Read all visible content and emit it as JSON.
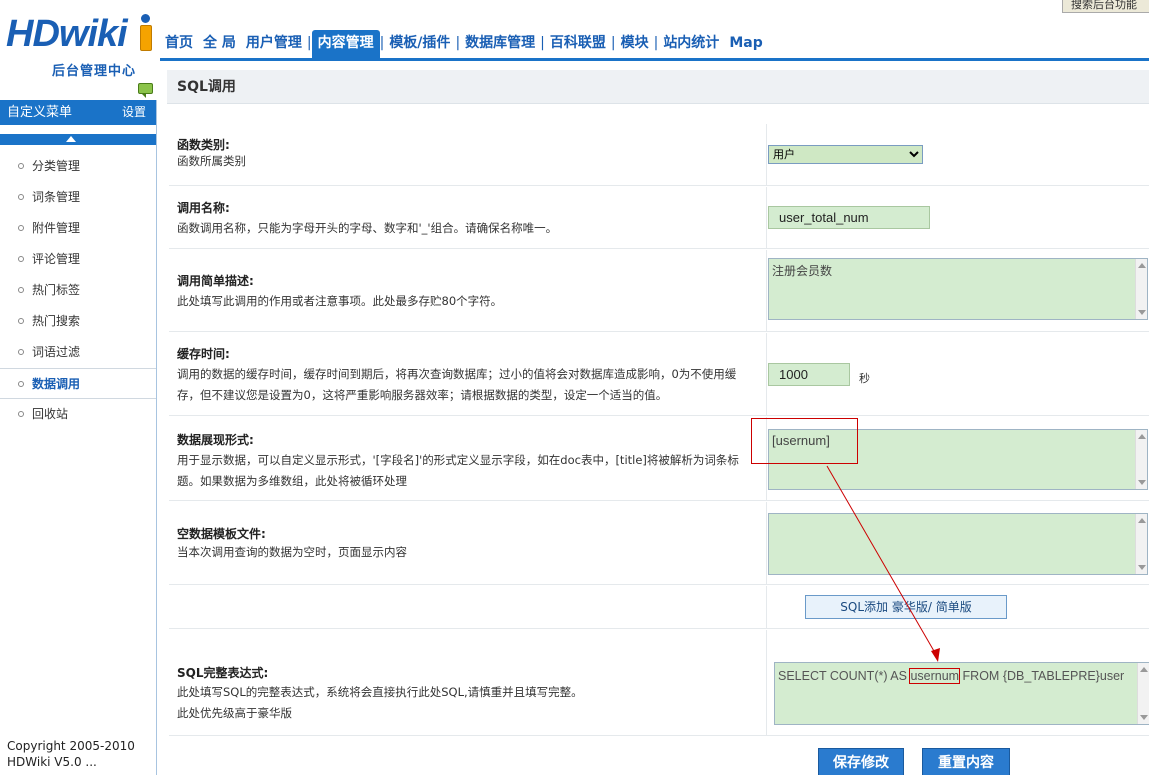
{
  "header": {
    "logo_text": "HDwiki",
    "logo_subtitle": "后台管理中心",
    "corner_hint": "搜索后台功能"
  },
  "nav": {
    "items": [
      {
        "label": "首页"
      },
      {
        "label": "全 局"
      },
      {
        "label": "用户管理"
      },
      {
        "label": "内容管理",
        "active": true
      },
      {
        "label": "模板/插件"
      },
      {
        "label": "数据库管理"
      },
      {
        "label": "百科联盟"
      },
      {
        "label": "模块"
      },
      {
        "label": "站内统计"
      },
      {
        "label": "Map"
      }
    ],
    "separator": "|"
  },
  "sidebar": {
    "title": "自定义菜单",
    "setting_label": "设置",
    "items": [
      {
        "label": "分类管理"
      },
      {
        "label": "词条管理"
      },
      {
        "label": "附件管理"
      },
      {
        "label": "评论管理"
      },
      {
        "label": "热门标签"
      },
      {
        "label": "热门搜索"
      },
      {
        "label": "词语过滤"
      },
      {
        "label": "数据调用",
        "active": true
      },
      {
        "label": "回收站"
      }
    ],
    "copyright_line1": "Copyright 2005-2010",
    "copyright_line2": "HDWiki V5.0 ..."
  },
  "page": {
    "title": "SQL调用"
  },
  "form": {
    "category": {
      "label": "函数类别:",
      "desc": "函数所属类别",
      "value": "用户"
    },
    "name": {
      "label": "调用名称:",
      "desc": "函数调用名称，只能为字母开头的字母、数字和'_'组合。请确保名称唯一。",
      "value": "user_total_num"
    },
    "summary": {
      "label": "调用简单描述:",
      "desc": "此处填写此调用的作用或者注意事项。此处最多存贮80个字符。",
      "value": "注册会员数"
    },
    "cache": {
      "label": "缓存时间:",
      "desc": "调用的数据的缓存时间，缓存时间到期后，将再次查询数据库；过小的值将会对数据库造成影响，0为不使用缓存，但不建议您是设置为0，这将严重影响服务器效率；请根据数据的类型，设定一个适当的值。",
      "value": "1000",
      "unit": "秒"
    },
    "display": {
      "label": "数据展现形式:",
      "desc": "用于显示数据，可以自定义显示形式，'[字段名]'的形式定义显示字段，如在doc表中，[title]将被解析为词条标题。如果数据为多维数组，此处将被循环处理",
      "value": "[usernum]"
    },
    "empty_tpl": {
      "label": "空数据模板文件:",
      "desc": "当本次调用查询的数据为空时，页面显示内容",
      "value": ""
    },
    "sql_mode_button": "SQL添加  豪华版/ 简单版",
    "sql": {
      "label": "SQL完整表达式:",
      "desc1": "此处填写SQL的完整表达式，系统将会直接执行此处SQL,请慎重并且填写完整。",
      "desc2": "此处优先级高于豪华版",
      "value_before": "SELECT COUNT(*) AS ",
      "value_highlight": "usernum",
      "value_after": " FROM {DB_TABLEPRE}user"
    },
    "save_button": "保存修改",
    "reset_button": "重置内容"
  },
  "colors": {
    "brand": "#1a5fb4",
    "nav_active": "#1a73c8",
    "field_bg": "#d4ecd0",
    "annotation": "#cc0000"
  }
}
